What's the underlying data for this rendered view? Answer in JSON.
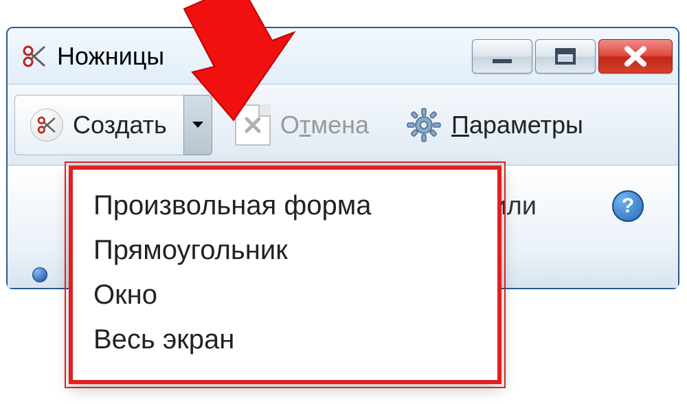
{
  "window": {
    "title": "Ножницы"
  },
  "toolbar": {
    "new_label": "Создать",
    "cancel_label": "Отмена",
    "cancel_underline_char": "т",
    "options_label": "Параметры",
    "options_underline_char": "П"
  },
  "dropdown": {
    "items": [
      "Произвольная форма",
      "Прямоугольник",
      "Окно",
      "Весь экран"
    ]
  },
  "content": {
    "hint_fragment": "или"
  }
}
